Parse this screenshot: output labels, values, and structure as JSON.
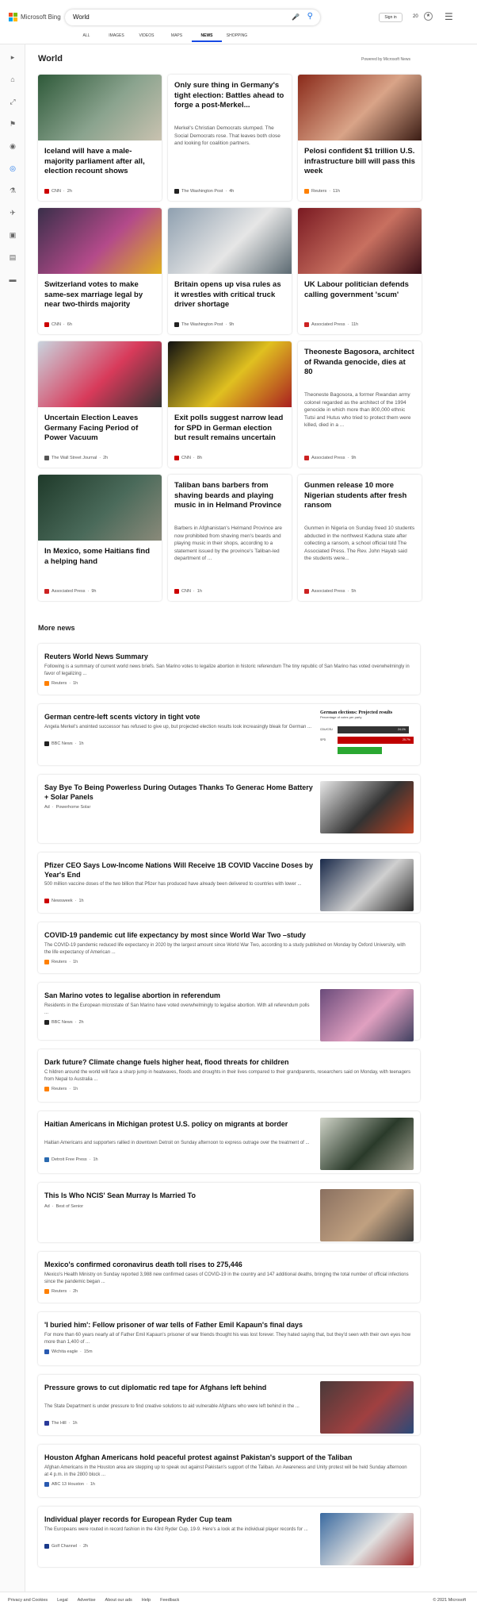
{
  "header": {
    "brand": "Microsoft Bing",
    "query": "World",
    "signin": "Sign in",
    "points": "20",
    "scopes": [
      {
        "label": "ALL",
        "active": false
      },
      {
        "label": "IMAGES",
        "active": false
      },
      {
        "label": "VIDEOS",
        "active": false
      },
      {
        "label": "MAPS",
        "active": false
      },
      {
        "label": "NEWS",
        "active": true
      },
      {
        "label": "SHOPPING",
        "active": false
      }
    ]
  },
  "rail": [
    "chevron-right-icon",
    "home-icon",
    "expand-icon",
    "flag-icon",
    "location-icon",
    "globe-icon",
    "science-icon",
    "rocket-icon",
    "tv-icon",
    "building-icon",
    "car-icon"
  ],
  "section": {
    "title": "World",
    "powered": "Powered by Microsoft News"
  },
  "cards": [
    {
      "title": "Iceland will have a male-majority parliament after all, election recount shows",
      "snippet": "",
      "source": "CNN",
      "time": "2h",
      "badge": "#cc0000",
      "img": [
        "#2f5a3a",
        "#8aa38e",
        "#c9c2b0"
      ]
    },
    {
      "title": "Only sure thing in Germany's tight election: Battles ahead to forge a post-Merkel...",
      "snippet": "Merkel's Christian Democrats slumped. The Social Democrats rose. That leaves both close and looking for coalition partners.",
      "source": "The Washington Post",
      "time": "4h",
      "badge": "#222222",
      "img": null
    },
    {
      "title": "Pelosi confident $1 trillion U.S. infrastructure bill will pass this week",
      "snippet": "",
      "source": "Reuters",
      "time": "11h",
      "badge": "#ff8000",
      "img": [
        "#8a2a1a",
        "#d9a488",
        "#3a1c14"
      ]
    },
    {
      "title": "Switzerland votes to make same-sex marriage legal by near two-thirds majority",
      "snippet": "",
      "source": "CNN",
      "time": "6h",
      "badge": "#cc0000",
      "img": [
        "#3a2f4a",
        "#b34a8a",
        "#e0b020"
      ]
    },
    {
      "title": "Britain opens up visa rules as it wrestles with critical truck driver shortage",
      "snippet": "",
      "source": "The Washington Post",
      "time": "9h",
      "badge": "#222222",
      "img": [
        "#8fa0b0",
        "#e6e6e6",
        "#5c6a72"
      ]
    },
    {
      "title": "UK Labour politician defends calling government 'scum'",
      "snippet": "",
      "source": "Associated Press",
      "time": "11h",
      "badge": "#cc2222",
      "img": [
        "#7a1a22",
        "#c87060",
        "#3a1018"
      ]
    },
    {
      "title": "Uncertain Election Leaves Germany Facing Period of Power Vacuum",
      "snippet": "",
      "source": "The Wall Street Journal",
      "time": "2h",
      "badge": "#555555",
      "img": [
        "#c9d4de",
        "#d83a5a",
        "#333333"
      ]
    },
    {
      "title": "Exit polls suggest narrow lead for SPD in German election but result remains uncertain",
      "snippet": "",
      "source": "CNN",
      "time": "8h",
      "badge": "#cc0000",
      "img": [
        "#111111",
        "#e0c020",
        "#aa2020"
      ]
    },
    {
      "title": "Theoneste Bagosora, architect of Rwanda genocide, dies at 80",
      "snippet": "Theoneste Bagosora, a former Rwandan army colonel regarded as the architect of the 1994 genocide in which more than 800,000 ethnic Tutsi and Hutus who tried to protect them were killed, died in a ...",
      "source": "Associated Press",
      "time": "9h",
      "badge": "#cc2222",
      "img": null
    },
    {
      "title": "In Mexico, some Haitians find a helping hand",
      "snippet": "",
      "source": "Associated Press",
      "time": "9h",
      "badge": "#cc2222",
      "img": [
        "#1f3a2a",
        "#4a6a5a",
        "#8a8a7a"
      ]
    },
    {
      "title": "Taliban bans barbers from shaving beards and playing music in in Helmand Province",
      "snippet": "Barbers in Afghanistan's Helmand Province are now prohibited from shaving men's beards and playing music in their shops, according to a statement issued by the province's Taliban-led department of ...",
      "source": "CNN",
      "time": "1h",
      "badge": "#cc0000",
      "img": null
    },
    {
      "title": "Gunmen release 10 more Nigerian students after fresh ransom",
      "snippet": "Gunmen in Nigeria on Sunday freed 10 students abducted in the northwest Kaduna state after collecting a ransom, a school official told The Associated Press. The Rev. John Hayab said the students were...",
      "source": "Associated Press",
      "time": "5h",
      "badge": "#cc2222",
      "img": null
    }
  ],
  "more": {
    "title": "More news",
    "items": [
      {
        "title": "Reuters World News Summary",
        "snippet": "Following is a summary of current world news briefs. San Marino votes to legalize abortion in historic referendum The tiny republic of San Marino has voted overwhelmingly in favor of legalizing ...",
        "source": "Reuters",
        "time": "1h",
        "ad": "",
        "badge": "#ff8000",
        "thumb": null
      },
      {
        "title": "German centre-left scents victory in tight vote",
        "snippet": "Angela Merkel's anointed successor has refused to give up, but projected election results look increasingly bleak for German ...",
        "source": "BBC News",
        "time": "1h",
        "ad": "",
        "badge": "#222222",
        "thumb": "chart"
      },
      {
        "title": "Say Bye To Being Powerless During Outages Thanks To Generac Home Battery + Solar Panels",
        "snippet": "",
        "source": "Powerhome Solar",
        "time": "",
        "ad": "Ad",
        "badge": "",
        "thumb": [
          "#e8e8e8",
          "#333333",
          "#c04020"
        ]
      },
      {
        "title": "Pfizer CEO Says Low-Income Nations Will Receive 1B COVID Vaccine Doses by Year's End",
        "snippet": "500 million vaccine doses of the two billion that Pfizer has produced have already been delivered to countries with lower ...",
        "source": "Newsweek",
        "time": "1h",
        "ad": "",
        "badge": "#cc0000",
        "thumb": [
          "#1a2a4a",
          "#d0d0d0",
          "#2a2a2a"
        ]
      },
      {
        "title": "COVID-19 pandemic cut life expectancy by most since World War Two –study",
        "snippet": "The COVID-19 pandemic reduced life expectancy in 2020 by the largest amount since World War Two, according to a study published on Monday by Oxford University, with the life expectancy of American ...",
        "source": "Reuters",
        "time": "1h",
        "ad": "",
        "badge": "#ff8000",
        "thumb": null
      },
      {
        "title": "San Marino votes to legalise abortion in referendum",
        "snippet": "Residents in the European microstate of San Marino have voted overwhelmingly to legalise abortion. With all referendum polls ...",
        "source": "BBC News",
        "time": "2h",
        "ad": "",
        "badge": "#222222",
        "thumb": [
          "#6a4a7a",
          "#e0a0c0",
          "#404060"
        ]
      },
      {
        "title": "Dark future? Climate change fuels higher heat, flood threats for children",
        "snippet": "C hildren around the world will face a sharp jump in heatwaves, floods and droughts in their lives compared to their grandparents, researchers said on Monday, with teenagers from Nepal to Australia ...",
        "source": "Reuters",
        "time": "1h",
        "ad": "",
        "badge": "#ff8000",
        "thumb": null
      },
      {
        "title": "Haitian Americans in Michigan protest U.S. policy on migrants at border",
        "snippet": "Haitian Americans and supporters rallied in downtown Detroit on Sunday afternoon to express outrage over the treatment of ...",
        "source": "Detroit Free Press",
        "time": "1h",
        "ad": "",
        "badge": "#2a6ab0",
        "thumb": [
          "#d0d4c8",
          "#2a3a2a",
          "#a0a090"
        ]
      },
      {
        "title": "This Is Who NCIS' Sean Murray Is Married To",
        "snippet": "",
        "source": "Best of Senior",
        "time": "",
        "ad": "Ad",
        "badge": "",
        "thumb": [
          "#8a7060",
          "#c0a080",
          "#3a3a3a"
        ]
      },
      {
        "title": "Mexico's confirmed coronavirus death toll rises to 275,446",
        "snippet": "Mexico's Health Ministry on Sunday reported 3,988 new confirmed cases of COVID-19 in the country and 147 additional deaths, bringing the total number of official infections since the pandemic began ...",
        "source": "Reuters",
        "time": "2h",
        "ad": "",
        "badge": "#ff8000",
        "thumb": null
      },
      {
        "title": "'I buried him': Fellow prisoner of war tells of Father Emil Kapaun's final days",
        "snippet": "For more than 60 years nearly all of Father Emil Kapaun's prisoner of war friends thought his was lost forever. They hated saying that, but they'd seen with their own eyes how more than 1,400 of ...",
        "source": "Wichita eagle",
        "time": "15m",
        "ad": "",
        "badge": "#2a5ab0",
        "thumb": null
      },
      {
        "title": "Pressure grows to cut diplomatic red tape for Afghans left behind",
        "snippet": "The State Department is under pressure to find creative solutions to aid vulnerable Afghans who were left behind in the ...",
        "source": "The Hill",
        "time": "1h",
        "ad": "",
        "badge": "#2a3a9a",
        "thumb": [
          "#4a3a3a",
          "#a04040",
          "#2a4a7a"
        ]
      },
      {
        "title": "Houston Afghan Americans hold peaceful protest against Pakistan's support of the Taliban",
        "snippet": "Afghan Americans in the Houston area are stepping up to speak out against Pakistan's support of the Taliban. An Awareness and Unity protest will be held Sunday afternoon at 4 p.m. in the 2800 block ...",
        "source": "ABC 13 Houston",
        "time": "1h",
        "ad": "",
        "badge": "#2a5ab0",
        "thumb": null
      },
      {
        "title": "Individual player records for European Ryder Cup team",
        "snippet": "The Europeans were routed in record fashion in the 43rd Ryder Cup, 19-9. Here's a look at the individual player records for ...",
        "source": "Golf Channel",
        "time": "2h",
        "ad": "",
        "badge": "#1a3a8a",
        "thumb": [
          "#3a6aa0",
          "#e0e0e0",
          "#a03030"
        ]
      }
    ]
  },
  "election_chart": {
    "title": "German elections: Projected results",
    "subtitle": "Percentage of votes per party",
    "rows": [
      {
        "label": "CDU/CSU",
        "value": "24.1%",
        "share": 0.241,
        "color": "#333333"
      },
      {
        "label": "SPD",
        "value": "25.7%",
        "share": 0.257,
        "color": "#c00000"
      },
      {
        "label": "",
        "value": "",
        "share": 0.15,
        "color": "#2aa832"
      }
    ]
  },
  "footer": {
    "links": [
      "Privacy and Cookies",
      "Legal",
      "Advertise",
      "About our ads",
      "Help",
      "Feedback"
    ],
    "copyright": "© 2021 Microsoft"
  }
}
